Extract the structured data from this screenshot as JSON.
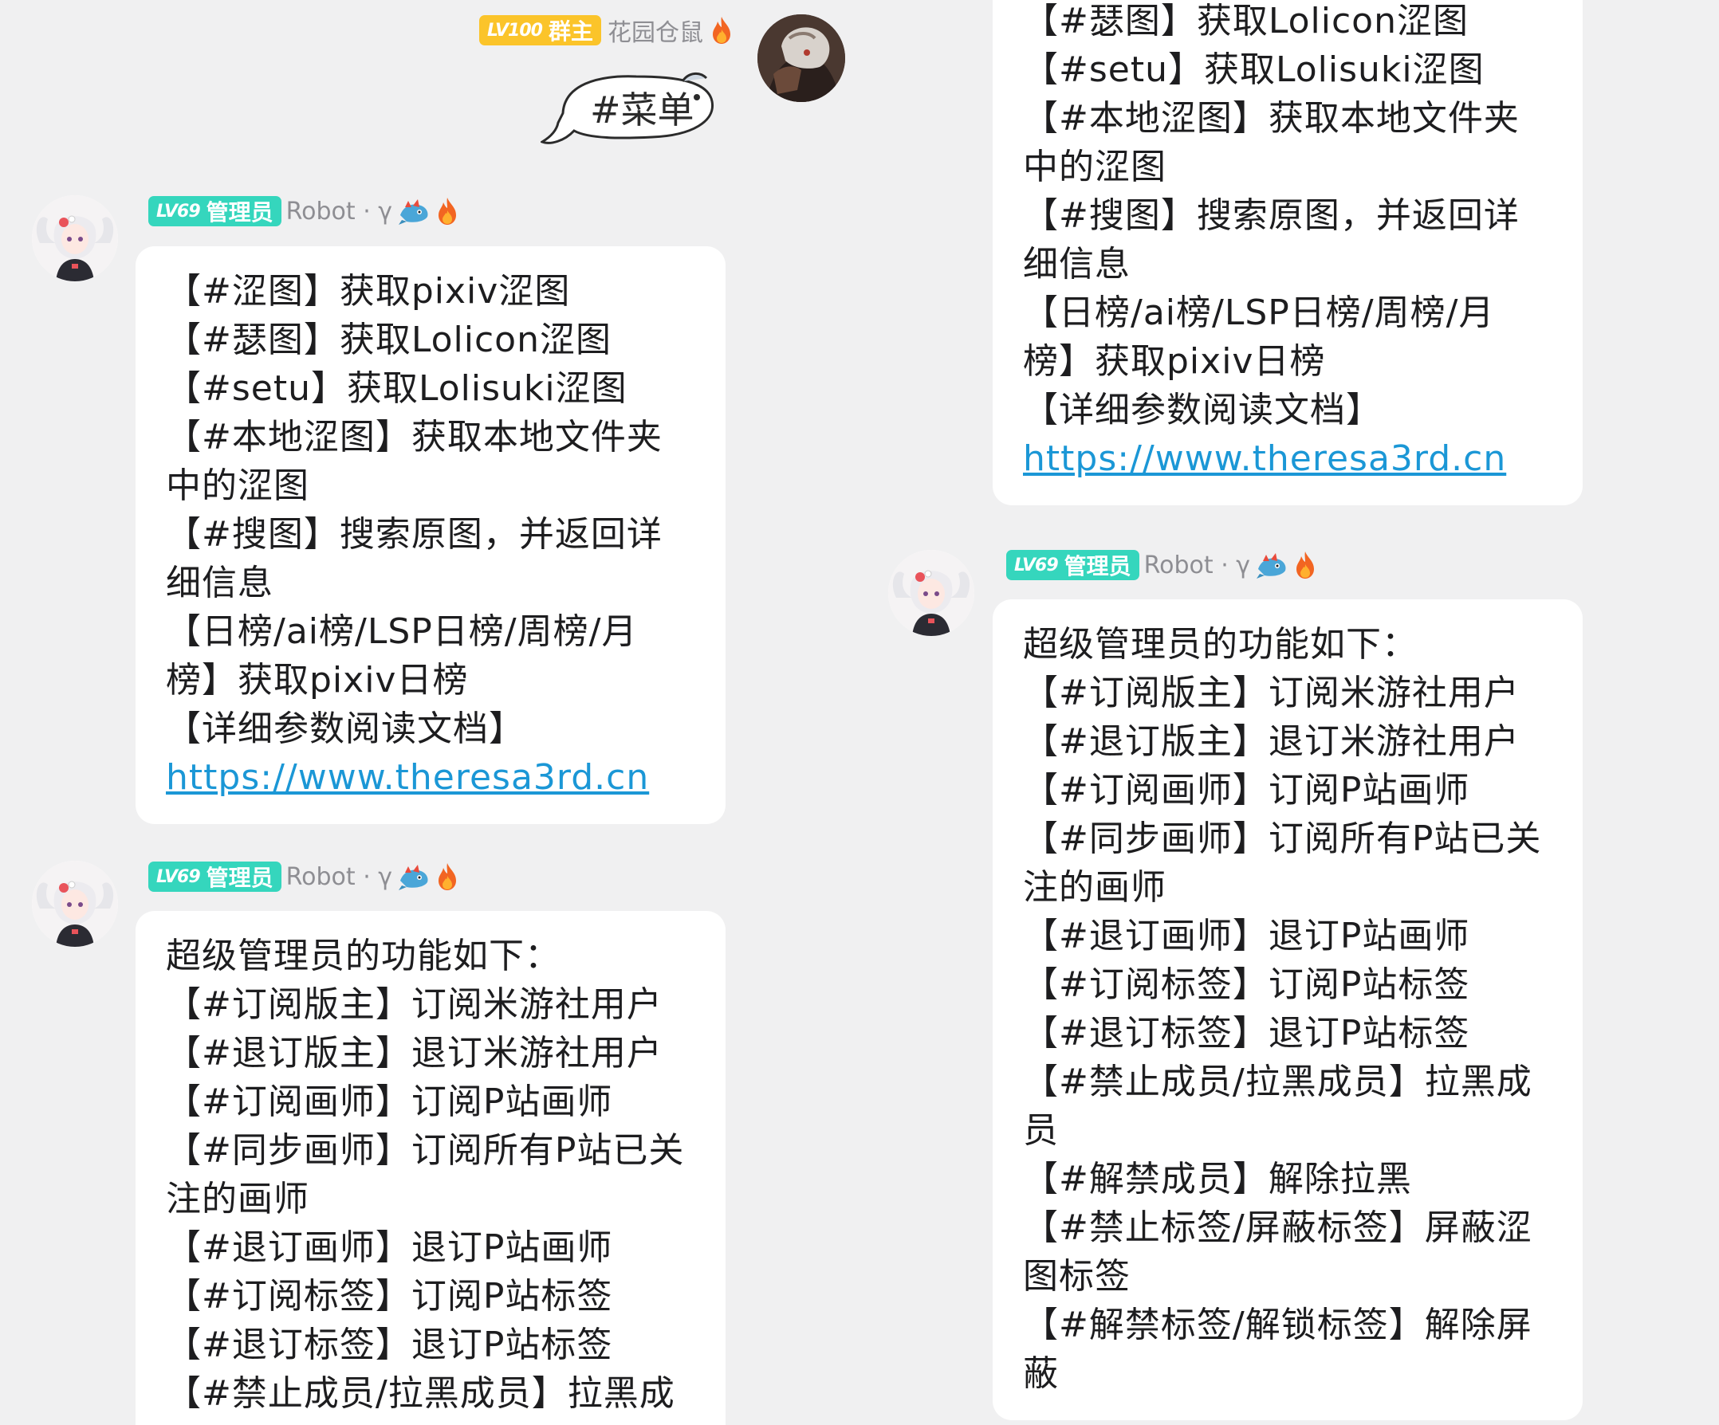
{
  "owner_message": {
    "badge_level": "LV100",
    "badge_role": "群主",
    "sender_name": "花园仓鼠",
    "sender_icon": "flame-icon",
    "content": "#菜单"
  },
  "bot": {
    "badge_level": "LV69",
    "badge_role": "管理员",
    "sender_name": "Robot · γ",
    "sender_icons": [
      "robot-dragon-icon",
      "flame-icon"
    ]
  },
  "menu_message": {
    "lines": [
      "【#涩图】获取pixiv涩图",
      "【#瑟图】获取Lolicon涩图",
      "【#setu】获取Lolisuki涩图",
      "【#本地涩图】获取本地文件夹",
      "中的涩图",
      "【#搜图】搜索原图，并返回详",
      "细信息",
      "【日榜/ai榜/LSP日榜/周榜/月",
      "榜】获取pixiv日榜",
      "【详细参数阅读文档】"
    ],
    "link": "https://www.theresa3rd.cn"
  },
  "menu_message_right_visible": {
    "lines": [
      "【#瑟图】获取Lolicon涩图",
      "【#setu】获取Lolisuki涩图",
      "【#本地涩图】获取本地文件夹",
      "中的涩图",
      "【#搜图】搜索原图，并返回详",
      "细信息",
      "【日榜/ai榜/LSP日榜/周榜/月",
      "榜】获取pixiv日榜",
      "【详细参数阅读文档】"
    ],
    "link": "https://www.theresa3rd.cn"
  },
  "admin_message_left": {
    "lines": [
      "超级管理员的功能如下：",
      "【#订阅版主】订阅米游社用户",
      "【#退订版主】退订米游社用户",
      "【#订阅画师】订阅P站画师",
      "【#同步画师】订阅所有P站已关",
      "注的画师",
      "【#退订画师】退订P站画师",
      "【#订阅标签】订阅P站标签",
      "【#退订标签】退订P站标签",
      "【#禁止成员/拉黑成员】拉黑成"
    ]
  },
  "admin_message_right": {
    "lines": [
      "超级管理员的功能如下：",
      "【#订阅版主】订阅米游社用户",
      "【#退订版主】退订米游社用户",
      "【#订阅画师】订阅P站画师",
      "【#同步画师】订阅所有P站已关",
      "注的画师",
      "【#退订画师】退订P站画师",
      "【#订阅标签】订阅P站标签",
      "【#退订标签】退订P站标签",
      "【#禁止成员/拉黑成员】拉黑成",
      "员",
      "【#解禁成员】解除拉黑",
      "【#禁止标签/屏蔽标签】屏蔽涩",
      "图标签",
      "【#解禁标签/解锁标签】解除屏",
      "蔽"
    ]
  },
  "colors": {
    "background": "#f0f0f1",
    "bubble": "#ffffff",
    "owner_badge": "#fbc42a",
    "admin_badge": "#35d6bd",
    "link": "#1b97d6",
    "name_gray": "#8e8e93"
  }
}
